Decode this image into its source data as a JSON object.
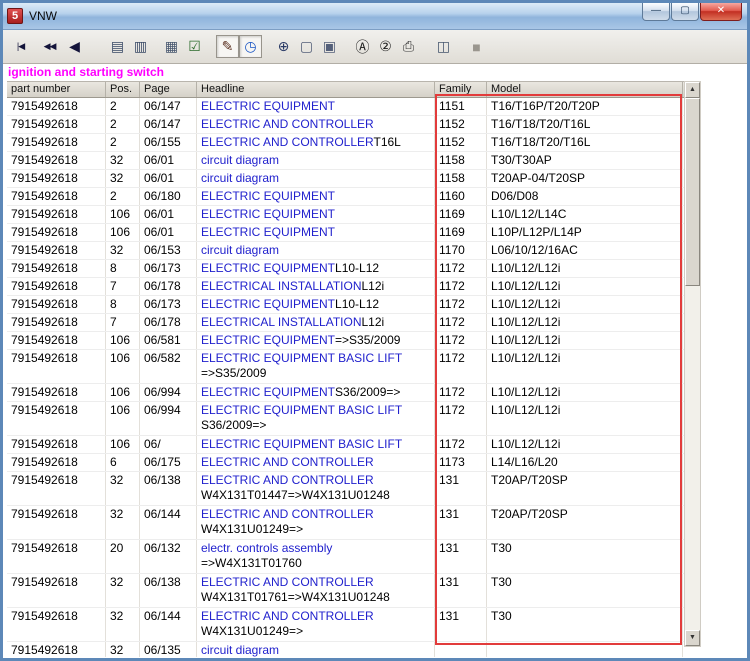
{
  "window": {
    "title": "VNW",
    "icon_text": "5",
    "controls": {
      "minimize": "—",
      "maximize": "▢",
      "close": "✕"
    }
  },
  "toolbar": {
    "items": [
      {
        "name": "nav-first",
        "glyph": "|◀",
        "ml": 0,
        "small": true,
        "color": "#14143a"
      },
      {
        "name": "nav-rewind",
        "glyph": "◀◀",
        "ml": 6,
        "small": true,
        "color": "#14143a"
      },
      {
        "name": "nav-prev",
        "glyph": "◀",
        "ml": 2,
        "small": false,
        "color": "#14143a"
      },
      {
        "name": "jump-page",
        "glyph": "▤",
        "ml": 20,
        "small": false,
        "color": "#3a4a66"
      },
      {
        "name": "edit-page",
        "glyph": "▥",
        "ml": 0,
        "small": false,
        "color": "#3a4a66"
      },
      {
        "name": "filter",
        "glyph": "▦",
        "ml": 8,
        "small": false,
        "color": "#46566e"
      },
      {
        "name": "checklist",
        "glyph": "☑",
        "ml": 0,
        "small": false,
        "color": "#2a6a2a"
      },
      {
        "name": "pointer-tool",
        "glyph": "✎",
        "ml": 10,
        "small": false,
        "color": "#5a3020",
        "pressed": true
      },
      {
        "name": "history",
        "glyph": "◷",
        "ml": 0,
        "small": false,
        "color": "#1a56c4",
        "pressed": true
      },
      {
        "name": "zoom",
        "glyph": "⊕",
        "ml": 10,
        "small": false,
        "color": "#2a3a66"
      },
      {
        "name": "single-page",
        "glyph": "▢",
        "ml": 0,
        "small": false,
        "color": "#55607a"
      },
      {
        "name": "multi-page",
        "glyph": "▣",
        "ml": 0,
        "small": false,
        "color": "#55607a"
      },
      {
        "name": "label-a",
        "glyph": "Ⓐ",
        "ml": 10,
        "small": false,
        "color": "#1a1a1a"
      },
      {
        "name": "label-2",
        "glyph": "②",
        "ml": 0,
        "small": false,
        "color": "#1a1a1a"
      },
      {
        "name": "print",
        "glyph": "⎙",
        "ml": 0,
        "small": false,
        "color": "#3a3a3a"
      },
      {
        "name": "catalog",
        "glyph": "◫",
        "ml": 12,
        "small": false,
        "color": "#46566e"
      },
      {
        "name": "stop",
        "glyph": "■",
        "ml": 10,
        "small": false,
        "color": "#9a968e"
      }
    ]
  },
  "page": {
    "title": "ignition and starting switch",
    "title_color": "#ff00ff"
  },
  "highlight": {
    "color": "#e23b3b"
  },
  "scrollbar": {
    "up": "▲",
    "down": "▼"
  },
  "table": {
    "columns": [
      {
        "key": "part",
        "label": "part number"
      },
      {
        "key": "pos",
        "label": "Pos."
      },
      {
        "key": "page",
        "label": "Page"
      },
      {
        "key": "headline",
        "label": "Headline"
      },
      {
        "key": "family",
        "label": "Family"
      },
      {
        "key": "model",
        "label": "Model"
      }
    ],
    "rows": [
      {
        "part": "7915492618",
        "pos": "2",
        "page": "06/147",
        "link": "ELECTRIC EQUIPMENT",
        "suffix": "",
        "line2": "",
        "family": "1151",
        "model": "T16/T16P/T20/T20P"
      },
      {
        "part": "7915492618",
        "pos": "2",
        "page": "06/147",
        "link": "ELECTRIC AND CONTROLLER",
        "suffix": "",
        "line2": "",
        "family": "1152",
        "model": "T16/T18/T20/T16L"
      },
      {
        "part": "7915492618",
        "pos": "2",
        "page": "06/155",
        "link": "ELECTRIC AND CONTROLLER",
        "suffix": "T16L",
        "line2": "",
        "family": "1152",
        "model": "T16/T18/T20/T16L"
      },
      {
        "part": "7915492618",
        "pos": "32",
        "page": "06/01",
        "link": "circuit diagram",
        "suffix": "",
        "line2": "",
        "family": "1158",
        "model": "T30/T30AP"
      },
      {
        "part": "7915492618",
        "pos": "32",
        "page": "06/01",
        "link": "circuit diagram",
        "suffix": "",
        "line2": "",
        "family": "1158",
        "model": "T20AP-04/T20SP"
      },
      {
        "part": "7915492618",
        "pos": "2",
        "page": "06/180",
        "link": "ELECTRIC EQUIPMENT",
        "suffix": "",
        "line2": "",
        "family": "1160",
        "model": "D06/D08"
      },
      {
        "part": "7915492618",
        "pos": "106",
        "page": "06/01",
        "link": "ELECTRIC EQUIPMENT",
        "suffix": "",
        "line2": "",
        "family": "1169",
        "model": "L10/L12/L14C"
      },
      {
        "part": "7915492618",
        "pos": "106",
        "page": "06/01",
        "link": "ELECTRIC EQUIPMENT",
        "suffix": "",
        "line2": "",
        "family": "1169",
        "model": "L10P/L12P/L14P"
      },
      {
        "part": "7915492618",
        "pos": "32",
        "page": "06/153",
        "link": "circuit diagram",
        "suffix": "",
        "line2": "",
        "family": "1170",
        "model": "L06/10/12/16AC"
      },
      {
        "part": "7915492618",
        "pos": "8",
        "page": "06/173",
        "link": "ELECTRIC EQUIPMENT",
        "suffix": "L10-L12",
        "line2": "",
        "family": "1172",
        "model": "L10/L12/L12i"
      },
      {
        "part": "7915492618",
        "pos": "7",
        "page": "06/178",
        "link": "ELECTRICAL INSTALLATION",
        "suffix": "L12i",
        "line2": "",
        "family": "1172",
        "model": "L10/L12/L12i"
      },
      {
        "part": "7915492618",
        "pos": "8",
        "page": "06/173",
        "link": "ELECTRIC EQUIPMENT",
        "suffix": "L10-L12",
        "line2": "",
        "family": "1172",
        "model": "L10/L12/L12i"
      },
      {
        "part": "7915492618",
        "pos": "7",
        "page": "06/178",
        "link": "ELECTRICAL INSTALLATION",
        "suffix": "L12i",
        "line2": "",
        "family": "1172",
        "model": "L10/L12/L12i"
      },
      {
        "part": "7915492618",
        "pos": "106",
        "page": "06/581",
        "link": "ELECTRIC EQUIPMENT",
        "suffix": "=>S35/2009",
        "line2": "",
        "family": "1172",
        "model": "L10/L12/L12i"
      },
      {
        "part": "7915492618",
        "pos": "106",
        "page": "06/582",
        "link": "ELECTRIC EQUIPMENT BASIC LIFT",
        "suffix": "",
        "line2": "=>S35/2009",
        "family": "1172",
        "model": "L10/L12/L12i"
      },
      {
        "part": "7915492618",
        "pos": "106",
        "page": "06/994",
        "link": "ELECTRIC EQUIPMENT",
        "suffix": "S36/2009=>",
        "line2": "",
        "family": "1172",
        "model": "L10/L12/L12i"
      },
      {
        "part": "7915492618",
        "pos": "106",
        "page": "06/994",
        "link": "ELECTRIC EQUIPMENT BASIC LIFT",
        "suffix": "",
        "line2": "S36/2009=>",
        "family": "1172",
        "model": "L10/L12/L12i"
      },
      {
        "part": "7915492618",
        "pos": "106",
        "page": "06/",
        "link": "ELECTRIC EQUIPMENT BASIC LIFT",
        "suffix": "",
        "line2": "",
        "family": "1172",
        "model": "L10/L12/L12i"
      },
      {
        "part": "7915492618",
        "pos": "6",
        "page": "06/175",
        "link": "ELECTRIC AND CONTROLLER",
        "suffix": "",
        "line2": "",
        "family": "1173",
        "model": "L14/L16/L20"
      },
      {
        "part": "7915492618",
        "pos": "32",
        "page": "06/138",
        "link": "ELECTRIC AND CONTROLLER",
        "suffix": "",
        "line2": "W4X131T01447=>W4X131U01248",
        "family": "131",
        "model": "T20AP/T20SP"
      },
      {
        "part": "7915492618",
        "pos": "32",
        "page": "06/144",
        "link": "ELECTRIC AND CONTROLLER",
        "suffix": "",
        "line2": "W4X131U01249=>",
        "family": "131",
        "model": "T20AP/T20SP"
      },
      {
        "part": "7915492618",
        "pos": "20",
        "page": "06/132",
        "link": "electr. controls assembly",
        "suffix": "",
        "line2": "=>W4X131T01760",
        "family": "131",
        "model": "T30"
      },
      {
        "part": "7915492618",
        "pos": "32",
        "page": "06/138",
        "link": "ELECTRIC AND CONTROLLER",
        "suffix": "",
        "line2": "W4X131T01761=>W4X131U01248",
        "family": "131",
        "model": "T30"
      },
      {
        "part": "7915492618",
        "pos": "32",
        "page": "06/144",
        "link": "ELECTRIC AND CONTROLLER",
        "suffix": "",
        "line2": "W4X131U01249=>",
        "family": "131",
        "model": "T30"
      },
      {
        "part": "7915492618",
        "pos": "32",
        "page": "06/135",
        "link": "circuit diagram",
        "suffix": "",
        "line2": "",
        "family": "",
        "model": ""
      }
    ]
  }
}
